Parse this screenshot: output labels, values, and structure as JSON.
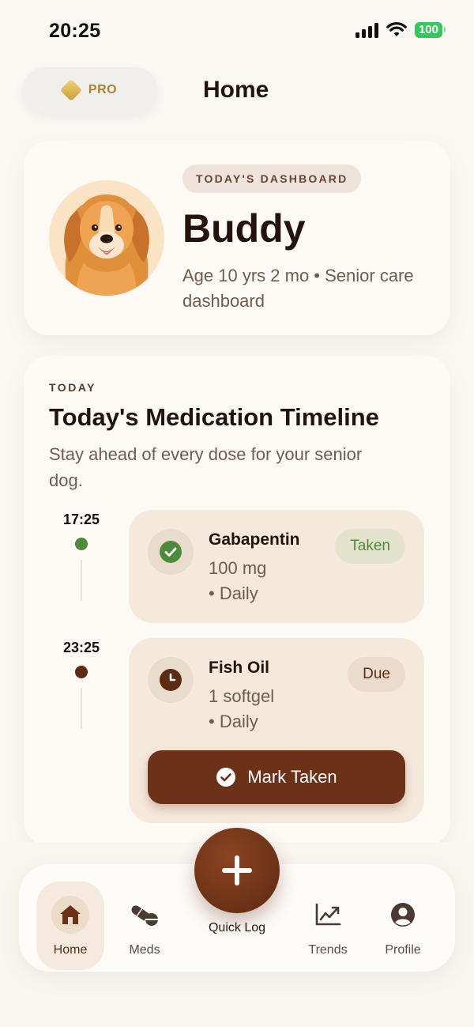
{
  "status_bar": {
    "time": "20:25",
    "battery": "100"
  },
  "header": {
    "pro_label": "PRO",
    "title": "Home"
  },
  "profile": {
    "badge": "TODAY'S DASHBOARD",
    "name": "Buddy",
    "subtitle": "Age 10 yrs 2 mo • Senior care dashboard"
  },
  "timeline": {
    "eyebrow": "TODAY",
    "title": "Today's Medication Timeline",
    "subtitle": "Stay ahead of every dose for your senior dog.",
    "doses": [
      {
        "time": "17:25",
        "name": "Gabapentin",
        "amount": "100 mg",
        "frequency": "• Daily",
        "status": "Taken",
        "status_color": "#4e8a3a",
        "icon": "check-icon"
      },
      {
        "time": "23:25",
        "name": "Fish Oil",
        "amount": "1 softgel",
        "frequency": "• Daily",
        "status": "Due",
        "status_color": "#6b3418",
        "icon": "clock-icon",
        "action": "Mark Taken"
      }
    ]
  },
  "nav": {
    "home": "Home",
    "meds": "Meds",
    "quick_log": "Quick Log",
    "trends": "Trends",
    "profile": "Profile"
  },
  "colors": {
    "accent": "#6c3217",
    "taken_green": "#4e8a3a",
    "background": "#fbf8f4"
  }
}
